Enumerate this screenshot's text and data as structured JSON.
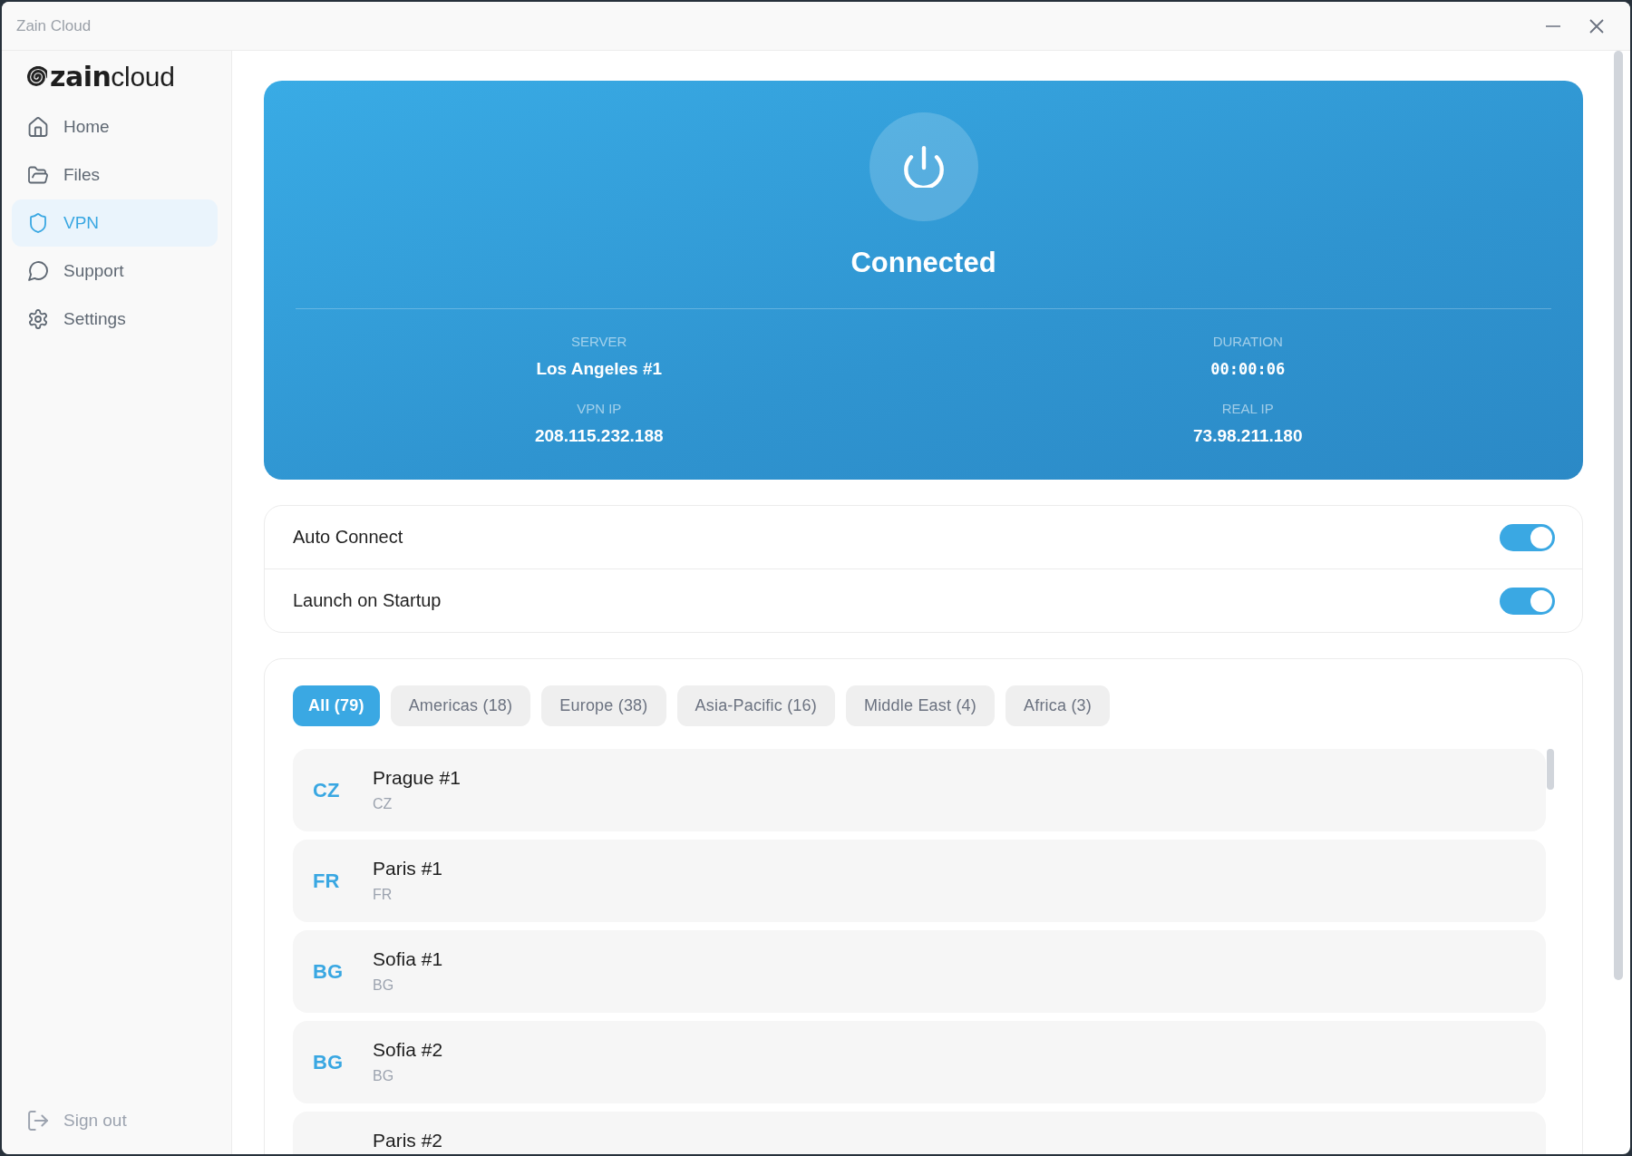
{
  "window": {
    "title": "Zain Cloud"
  },
  "sidebar": {
    "logo": "**zain**cloud",
    "items": [
      {
        "label": "Home",
        "selected": false
      },
      {
        "label": "Files",
        "selected": false
      },
      {
        "label": "VPN",
        "selected": true
      },
      {
        "label": "Support",
        "selected": false
      },
      {
        "label": "Settings",
        "selected": false
      }
    ],
    "footer": {
      "label": "Sign out"
    }
  },
  "status": {
    "connected": true,
    "label": "Connected",
    "details": [
      {
        "kind": "text",
        "label": "SERVER",
        "value": "Los Angeles #1"
      },
      {
        "kind": "timer",
        "label": "DURATION",
        "value": "00:00:06"
      },
      {
        "kind": "text",
        "label": "VPN IP",
        "value": "208.115.232.188"
      },
      {
        "kind": "text",
        "label": "REAL IP",
        "value": "73.98.211.180"
      }
    ]
  },
  "settings": [
    {
      "label": "Auto Connect",
      "on": true
    },
    {
      "label": "Launch on Startup",
      "on": true
    }
  ],
  "filters": [
    {
      "label": "All (79)",
      "selected": true
    },
    {
      "label": "Americas (18)",
      "selected": false
    },
    {
      "label": "Europe (38)",
      "selected": false
    },
    {
      "label": "Asia-Pacific (16)",
      "selected": false
    },
    {
      "label": "Middle East (4)",
      "selected": false
    },
    {
      "label": "Africa (3)",
      "selected": false
    }
  ],
  "servers": [
    {
      "code": "CZ",
      "name": "Prague #1",
      "country": "CZ"
    },
    {
      "code": "FR",
      "name": "Paris #1",
      "country": "FR"
    },
    {
      "code": "BG",
      "name": "Sofia #1",
      "country": "BG"
    },
    {
      "code": "BG",
      "name": "Sofia #2",
      "country": "BG"
    },
    {
      "name": "Paris #2"
    }
  ]
}
